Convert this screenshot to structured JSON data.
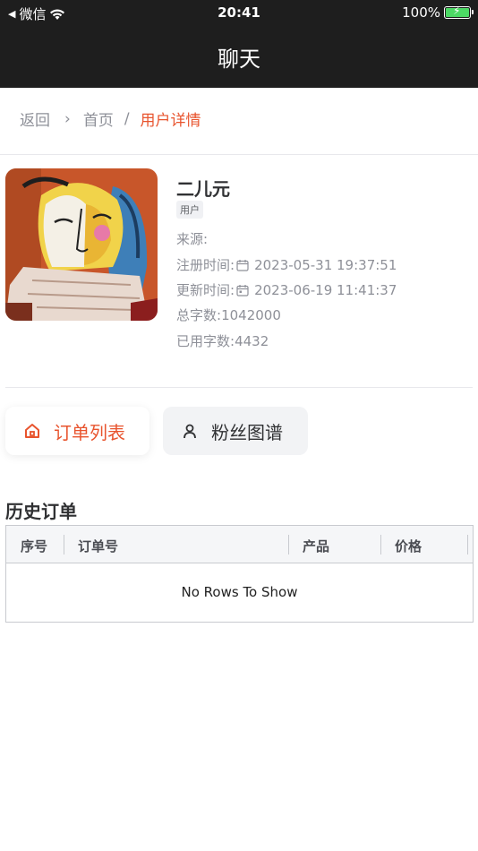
{
  "status_bar": {
    "back_app": "微信",
    "time": "20:41",
    "battery": "100%"
  },
  "nav": {
    "title": "聊天"
  },
  "breadcrumb": {
    "back": "返回",
    "home": "首页",
    "current": "用户详情"
  },
  "user": {
    "name": "二儿元",
    "tag": "用户",
    "source_label": "来源:",
    "source_value": "",
    "register_label": "注册时间:",
    "register_value": "2023-05-31 19:37:51",
    "update_label": "更新时间:",
    "update_value": "2023-06-19 11:41:37",
    "total_chars_label": "总字数:",
    "total_chars_value": "1042000",
    "used_chars_label": "已用字数:",
    "used_chars_value": "4432"
  },
  "tabs": {
    "orders": "订单列表",
    "fans": "粉丝图谱"
  },
  "history": {
    "title": "历史订单",
    "columns": [
      "序号",
      "订单号",
      "产品",
      "价格"
    ],
    "empty_text": "No Rows To Show"
  },
  "colors": {
    "accent": "#e8542e",
    "nav_bg": "#1e1e1e"
  }
}
